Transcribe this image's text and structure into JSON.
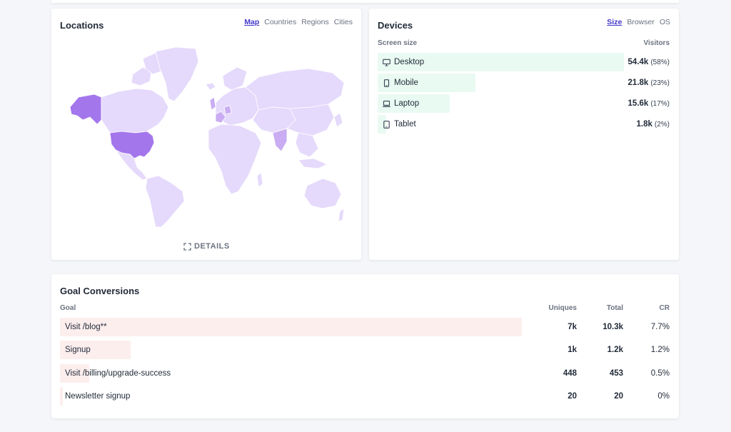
{
  "locations": {
    "title": "Locations",
    "tabs": [
      "Map",
      "Countries",
      "Regions",
      "Cities"
    ],
    "active_tab": "Map",
    "details_label": "DETAILS",
    "colors": {
      "high": "#a476ec",
      "mid": "#c9acf2",
      "low": "#e5dafb",
      "border": "#ffffff"
    }
  },
  "devices": {
    "title": "Devices",
    "tabs": [
      "Size",
      "Browser",
      "OS"
    ],
    "active_tab": "Size",
    "col_label": "Screen size",
    "col_value": "Visitors",
    "bar_color": "#e9faf2",
    "rows": [
      {
        "icon": "desktop-icon",
        "label": "Desktop",
        "value": "54.4k",
        "pct": "(58%)",
        "share": 58
      },
      {
        "icon": "mobile-icon",
        "label": "Mobile",
        "value": "21.8k",
        "pct": "(23%)",
        "share": 23
      },
      {
        "icon": "laptop-icon",
        "label": "Laptop",
        "value": "15.6k",
        "pct": "(17%)",
        "share": 17
      },
      {
        "icon": "tablet-icon",
        "label": "Tablet",
        "value": "1.8k",
        "pct": "(2%)",
        "share": 2
      }
    ]
  },
  "goals": {
    "title": "Goal Conversions",
    "columns": {
      "goal": "Goal",
      "uniques": "Uniques",
      "total": "Total",
      "cr": "CR"
    },
    "bar_color": "#fdeeee",
    "rows": [
      {
        "goal": "Visit /blog**",
        "uniques": "7k",
        "total": "10.3k",
        "cr": "7.7%",
        "share": 7.7
      },
      {
        "goal": "Signup",
        "uniques": "1k",
        "total": "1.2k",
        "cr": "1.2%",
        "share": 1.2
      },
      {
        "goal": "Visit /billing/upgrade-success",
        "uniques": "448",
        "total": "453",
        "cr": "0.5%",
        "share": 0.5
      },
      {
        "goal": "Newsletter signup",
        "uniques": "20",
        "total": "20",
        "cr": "0%",
        "share": 0.05
      }
    ]
  }
}
